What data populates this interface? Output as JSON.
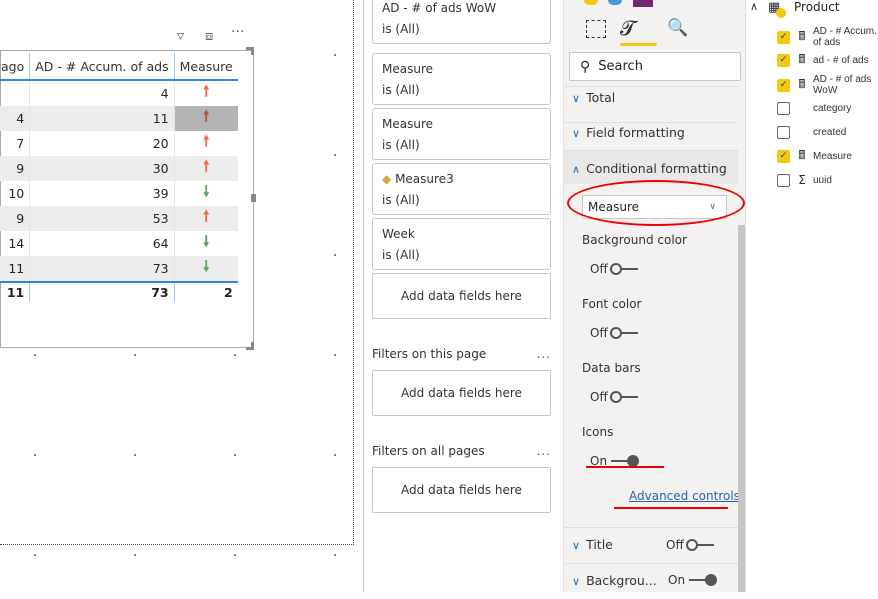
{
  "table": {
    "headers": [
      "ago",
      "AD - # Accum. of ads",
      "Measure"
    ],
    "rows": [
      {
        "c1": "",
        "c2": "4",
        "trend": "up"
      },
      {
        "c1": "4",
        "c2": "11",
        "trend": "up"
      },
      {
        "c1": "7",
        "c2": "20",
        "trend": "up"
      },
      {
        "c1": "9",
        "c2": "30",
        "trend": "up"
      },
      {
        "c1": "10",
        "c2": "39",
        "trend": "down"
      },
      {
        "c1": "9",
        "c2": "53",
        "trend": "up"
      },
      {
        "c1": "14",
        "c2": "64",
        "trend": "down"
      },
      {
        "c1": "11",
        "c2": "73",
        "trend": "down"
      }
    ],
    "total": {
      "c1": "11",
      "c2": "73",
      "c3": "2"
    },
    "up_color": "#f2674a",
    "down_color": "#5ba55b"
  },
  "filters": {
    "cards": [
      {
        "name": "AD - # of ads WoW",
        "value": "is (All)"
      },
      {
        "name": "Measure",
        "value": "is (All)"
      },
      {
        "name": "Measure",
        "value": "is (All)"
      },
      {
        "name": "Measure3",
        "value": "is (All)",
        "warning": true
      },
      {
        "name": "Week",
        "value": "is (All)"
      }
    ],
    "add_label": "Add data fields here",
    "page_heading": "Filters on this page",
    "all_heading": "Filters on all pages",
    "more": "..."
  },
  "format": {
    "search_placeholder": "Search",
    "sections": {
      "total": "Total",
      "field_formatting": "Field formatting",
      "conditional": "Conditional formatting",
      "title": "Title",
      "background": "Backgrou..."
    },
    "measure_select": "Measure",
    "background_color": "Background color",
    "font_color": "Font color",
    "data_bars": "Data bars",
    "icons": "Icons",
    "off": "Off",
    "on": "On",
    "advanced": "Advanced controls"
  },
  "fields": {
    "table_name": "Product",
    "items": [
      {
        "label": "AD - # Accum. of ads",
        "checked": true,
        "type": "calc"
      },
      {
        "label": "ad - # of ads",
        "checked": true,
        "type": "calc"
      },
      {
        "label": "AD - # of ads WoW",
        "checked": true,
        "type": "calc"
      },
      {
        "label": "category",
        "checked": false,
        "type": ""
      },
      {
        "label": "created",
        "checked": false,
        "type": ""
      },
      {
        "label": "Measure",
        "checked": true,
        "type": "calc"
      },
      {
        "label": "uuid",
        "checked": false,
        "type": "sum"
      }
    ]
  }
}
